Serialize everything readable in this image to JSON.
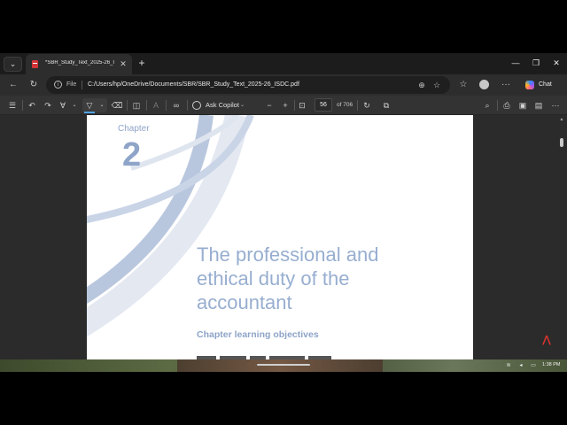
{
  "browser": {
    "tab": {
      "title": "*SBR_Study_Text_2025-26_ISDC.pdf",
      "close_glyph": "✕"
    },
    "new_tab_glyph": "+",
    "window_controls": {
      "minimize": "—",
      "restore": "❐",
      "close": "✕"
    },
    "address": {
      "scheme_label": "File",
      "url": "C:/Users/hp/OneDrive/Documents/SBR/SBR_Study_Text_2025-26_ISDC.pdf"
    },
    "chat_label": "Chat",
    "more_glyph": "···"
  },
  "pdf_toolbar": {
    "ask_copilot_label": "Ask Copilot",
    "zoom_out_glyph": "−",
    "zoom_in_glyph": "+",
    "current_page": "56",
    "total_pages_label": "of 706"
  },
  "document": {
    "chapter_label": "Chapter",
    "chapter_number": "2",
    "chapter_title": "The professional and ethical duty of the accountant",
    "objectives_heading": "Chapter learning objectives"
  },
  "taskbar": {
    "time": "1:38 PM"
  },
  "icons": [
    "tab-actions-icon",
    "pdf-file-icon",
    "back-icon",
    "refresh-icon",
    "info-icon",
    "zoom-icon",
    "favorite-star-icon",
    "favorites-icon",
    "profile-avatar",
    "copilot-icon",
    "contents-icon",
    "undo-icon",
    "redo-icon",
    "highlight-icon",
    "draw-icon",
    "erase-icon",
    "page-view-icon",
    "read-aloud-icon",
    "fit-page-icon",
    "rotate-icon",
    "two-page-icon",
    "search-icon",
    "print-icon",
    "save-icon",
    "save-as-icon",
    "settings-more-icon",
    "acrobat-icon",
    "wifi-icon",
    "volume-icon",
    "battery-icon"
  ]
}
